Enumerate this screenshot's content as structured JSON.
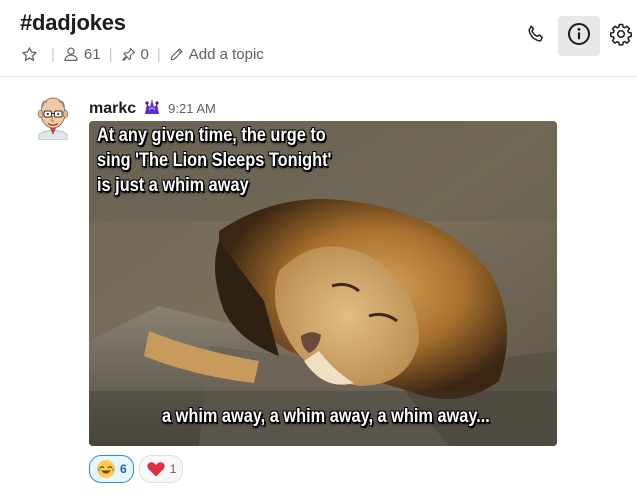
{
  "header": {
    "channel": "#dadjokes",
    "members": "61",
    "pins": "0",
    "topic_placeholder": "Add a topic"
  },
  "icons": {
    "star": "star-icon",
    "members": "person-icon",
    "pin": "pin-icon",
    "topic": "pencil-icon",
    "call": "phone-icon",
    "info": "info-icon",
    "settings": "gear-icon"
  },
  "message": {
    "sender": "markc",
    "time": "9:21 AM",
    "meme": {
      "top_lines": [
        "At any given time, the urge to",
        "sing 'The Lion Sleeps Tonight'",
        "is just a whim away"
      ],
      "bottom_line": "a whim away, a whim away, a whim away..."
    },
    "reactions": [
      {
        "emoji": "joy-emoji",
        "count": "6",
        "active": true
      },
      {
        "emoji": "red-heart-emoji",
        "count": "1",
        "active": false
      }
    ]
  },
  "colors": {
    "accent": "#1264a3",
    "reaction_active_bg": "#e8f5fa",
    "info_button_bg": "#e8e8e8"
  }
}
